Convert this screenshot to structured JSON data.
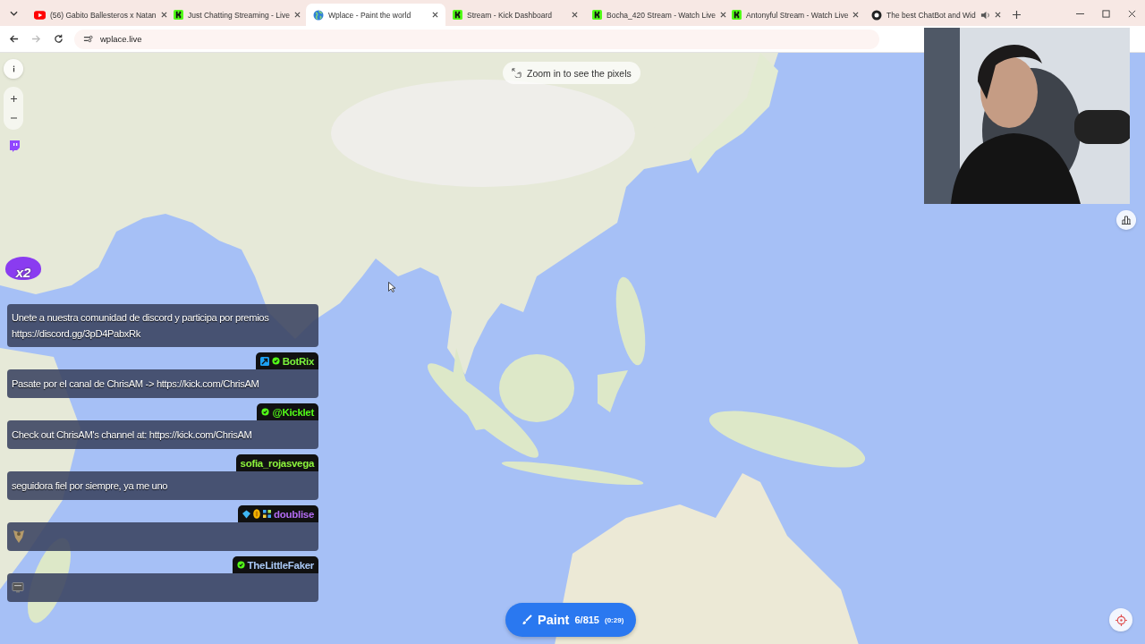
{
  "browser": {
    "tabs": [
      {
        "title": "(56) Gabito Ballesteros x Natan",
        "kind": "video",
        "selected": false,
        "audio": false
      },
      {
        "title": "Just Chatting Streaming - Live",
        "kind": "kick",
        "selected": false,
        "audio": false
      },
      {
        "title": "Wplace - Paint the world",
        "kind": "globe",
        "selected": true,
        "audio": false
      },
      {
        "title": "Stream - Kick Dashboard",
        "kind": "kick",
        "selected": false,
        "audio": false
      },
      {
        "title": "Bocha_420 Stream - Watch Live",
        "kind": "kick",
        "selected": false,
        "audio": false
      },
      {
        "title": "Antonyful Stream - Watch Live",
        "kind": "kick",
        "selected": false,
        "audio": false
      },
      {
        "title": "The best ChatBot and Wid",
        "kind": "bot",
        "selected": false,
        "audio": true
      }
    ],
    "url": "wplace.live"
  },
  "map": {
    "hint": "Zoom in to see the pixels",
    "paint_button": {
      "label": "Paint",
      "charges": "6/815",
      "cooldown": "(0:29)"
    }
  },
  "stream_overlay": {
    "multiplier_badge": "x2",
    "chat": [
      {
        "kind": "text",
        "text": "Unete a nuestra comunidad de discord y participa por premios https://discord.gg/3pD4PabxRk"
      },
      {
        "kind": "text",
        "user": {
          "name": "BotRix",
          "color": "#7cf53c",
          "badges": [
            {
              "kind": "bot"
            },
            {
              "kind": "verified"
            }
          ]
        },
        "text": "Pasate por el canal de ChrisAM -> https://kick.com/ChrisAM"
      },
      {
        "kind": "text",
        "user": {
          "name": "@Kicklet",
          "color": "#53fc18",
          "badges": [
            {
              "kind": "verified"
            }
          ]
        },
        "text": "Check out ChrisAM's channel at: https://kick.com/ChrisAM"
      },
      {
        "kind": "text",
        "user": {
          "name": "sofia_rojasvega",
          "color": "#8df53c"
        },
        "text": "seguidora fiel por siempre, ya me uno"
      },
      {
        "kind": "wings",
        "user": {
          "name": "doublise",
          "color": "#b36cf2",
          "badges": [
            {
              "kind": "gem"
            },
            {
              "kind": "coin"
            },
            {
              "kind": "grid"
            }
          ]
        }
      },
      {
        "kind": "screen",
        "user": {
          "name": "TheLittleFaker",
          "color": "#a9c8f5",
          "badges": [
            {
              "kind": "verified"
            }
          ]
        }
      }
    ]
  }
}
